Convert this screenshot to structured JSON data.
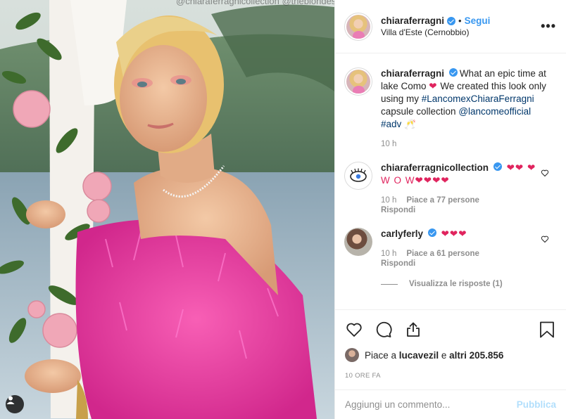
{
  "photo": {
    "overlay_text": "@chiaraferragnicollection @theblondesalad @beauty-bites",
    "tag_icon": "person-tag-icon"
  },
  "header": {
    "username": "chiaraferragni",
    "separator": "•",
    "follow_label": "Segui",
    "location": "Villa d'Este (Cernobbio)",
    "more_label": "•••"
  },
  "caption": {
    "username": "chiaraferragni",
    "text_1": "What an epic time at lake Como ",
    "heart": "❤",
    "text_2": " We created this look only using my ",
    "hashtag_1": "#LancomexChiaraFerragni",
    "text_3": " capsule collection ",
    "mention": "@lancomeofficial",
    "hashtag_2": "#adv",
    "text_4": " 🥂",
    "time": "10 h"
  },
  "comments": [
    {
      "username": "chiaraferragnicollection",
      "text": "❤❤ ❤W O W❤❤❤❤",
      "time": "10 h",
      "likes": "Piace a 77 persone",
      "reply": "Rispondi"
    },
    {
      "username": "carlyferly",
      "text": "❤❤❤",
      "time": "10 h",
      "likes": "Piace a 61 persone",
      "reply": "Rispondi"
    }
  ],
  "view_replies": "Visualizza le risposte (1)",
  "likes_line": {
    "prefix": "Piace a ",
    "user": "lucavezil",
    "mid": " e ",
    "others": "altri 205.856"
  },
  "time_ago": "10 ORE FA",
  "add_comment": {
    "placeholder": "Aggiungi un commento...",
    "publish_label": "Pubblica"
  }
}
